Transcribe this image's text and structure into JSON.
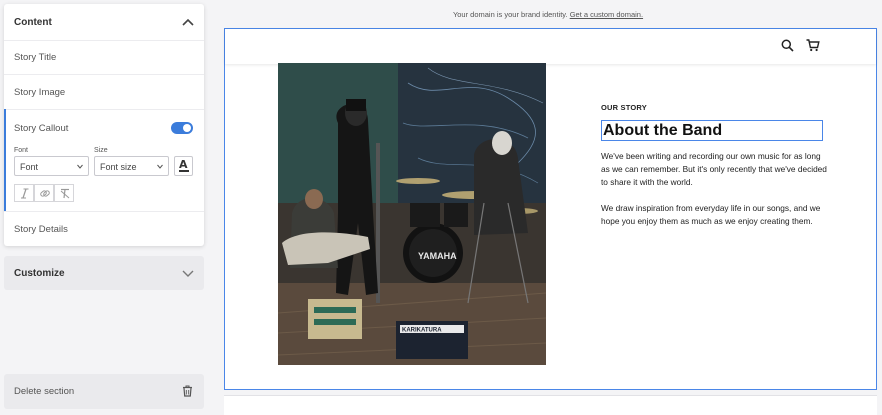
{
  "panel": {
    "content": {
      "title": "Content",
      "rows": {
        "story_title": "Story Title",
        "story_image": "Story Image",
        "story_callout": "Story Callout",
        "story_details": "Story Details"
      },
      "callout": {
        "toggle_on": true,
        "font_label": "Font",
        "font_value": "Font",
        "size_label": "Size",
        "size_value": "Font size",
        "color_glyph": "A"
      }
    },
    "customize": {
      "title": "Customize"
    },
    "delete": {
      "label": "Delete section"
    }
  },
  "preview": {
    "banner": {
      "text": "Your domain is your brand identity.",
      "link": "Get a custom domain."
    },
    "story": {
      "eyebrow": "OUR STORY",
      "title": "About the Band",
      "paragraph1": "We've been writing and recording our own music for as long as we can remember. But it's only recently that we've decided to share it with the world.",
      "paragraph2": "We draw inspiration from everyday life in our songs, and we hope you enjoy them as much as we enjoy creating them."
    },
    "photo": {
      "drum_brand": "YAMAHA",
      "sign_text": "KARIKATURA"
    }
  },
  "colors": {
    "accent": "#3b7cdb",
    "frame_border": "#4a86e8"
  }
}
